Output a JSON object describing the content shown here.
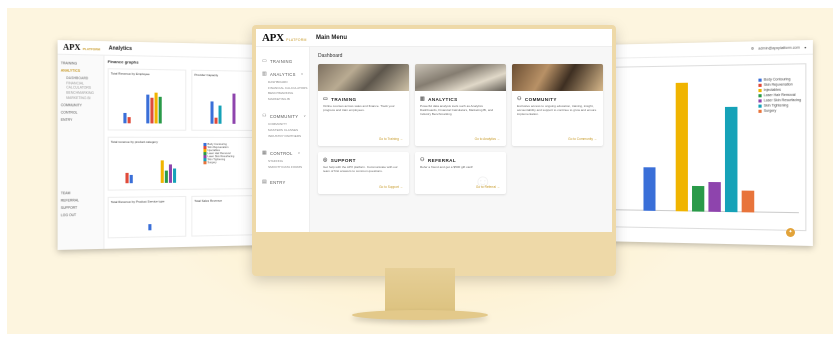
{
  "brand": {
    "logo": "APX",
    "logo_sub": "PLATFORM"
  },
  "left_screen": {
    "title": "Analytics",
    "heading": "Finance graphs",
    "sidebar": [
      "TRAINING",
      "ANALYTICS",
      "DASHBOARD",
      "FINANCIAL CALCULATORS",
      "BENCHMARKING",
      "MARKETING BI",
      "COMMUNITY",
      "CONTROL",
      "ENTRY",
      "TEAM",
      "REFERRAL",
      "SUPPORT",
      "LOG OUT"
    ],
    "charts": [
      {
        "title": "Total Revenue by Employee",
        "subtitle": "Total Cash Revenue – Employee"
      },
      {
        "title": "Provider Capacity",
        "subtitle": "Total Revenue by Provider Name"
      },
      {
        "title": "Total revenue by product category",
        "subtitle": "Total Revenue by Product Category"
      },
      {
        "title": "Total Revenue by Product Service type",
        "subtitle": "Total Revenue - By Service"
      },
      {
        "title": "Total Sales Revenue",
        "subtitle": "Total Sales Revenue"
      }
    ],
    "legend": [
      "Body Contouring",
      "Skin Rejuvenation",
      "Injectables",
      "Laser Hair Removal",
      "Laser Skin Resurfacing",
      "Skin Tightening",
      "Surgery"
    ],
    "legend_colors": [
      "#3a6fd8",
      "#e04b3a",
      "#f0b400",
      "#2a9a49",
      "#8e44ad",
      "#16a2b8",
      "#e8743b"
    ]
  },
  "right_screen": {
    "user": "admin@apxplatform.com",
    "legend": [
      "Body Contouring",
      "Skin Rejuvenation",
      "Injectables",
      "Laser Hair Removal",
      "Laser Skin Resurfacing",
      "Skin Tightening",
      "Surgery"
    ],
    "chart_data": {
      "type": "bar",
      "categories": [
        "Body Contouring",
        "Skin Rejuvenation",
        "Injectables",
        "Laser Hair Removal",
        "Laser Skin Resurfacing",
        "Skin Tightening",
        "Surgery"
      ],
      "values": [
        34,
        0,
        100,
        20,
        23,
        81,
        17
      ],
      "colors": [
        "#3a6fd8",
        "#e04b3a",
        "#f0b400",
        "#2a9a49",
        "#8e44ad",
        "#16a2b8",
        "#e8743b"
      ]
    }
  },
  "monitor": {
    "header_title": "Main Menu",
    "page_title": "Dashboard",
    "sidebar": {
      "training": "TRAINING",
      "analytics": "ANALYTICS",
      "analytics_sub": [
        "DASHBOARD",
        "FINANCIAL CALCULATORS",
        "BENCHMARKING",
        "MARKETING BI"
      ],
      "community": "COMMUNITY",
      "community_sub": [
        "COMMUNITY",
        "MASTERS CLASSES",
        "INDUSTRY PARTNERS"
      ],
      "control": "CONTROL",
      "control_sub": [
        "STAFFING",
        "SMOOTH DATA FORMS"
      ],
      "entry": "ENTRY"
    },
    "cards": [
      {
        "title": "TRAINING",
        "desc": "Online courses across sales and finance. Track your progress and train employees.",
        "link": "Go to Training →"
      },
      {
        "title": "ANALYTICS",
        "desc": "Powerful data analysis tools such as Analytics Dashboards, Financial Calculators, Marketing BI, and Industry Benchmarking",
        "link": "Go to Analytics →"
      },
      {
        "title": "COMMUNITY",
        "desc": "Exclusive access to ongoing education, training, insight, accountability and support to continue to grow and ensure implementation.",
        "link": "Go to Community →"
      }
    ],
    "cards2": [
      {
        "title": "SUPPORT",
        "desc": "Get help with the APX platform. Communicate with our team of first answers to common questions.",
        "link": "Go to Support →"
      },
      {
        "title": "REFERRAL",
        "desc": "Refer a friend and get a $500 gift card!",
        "link": "Go to Referral →"
      }
    ]
  }
}
